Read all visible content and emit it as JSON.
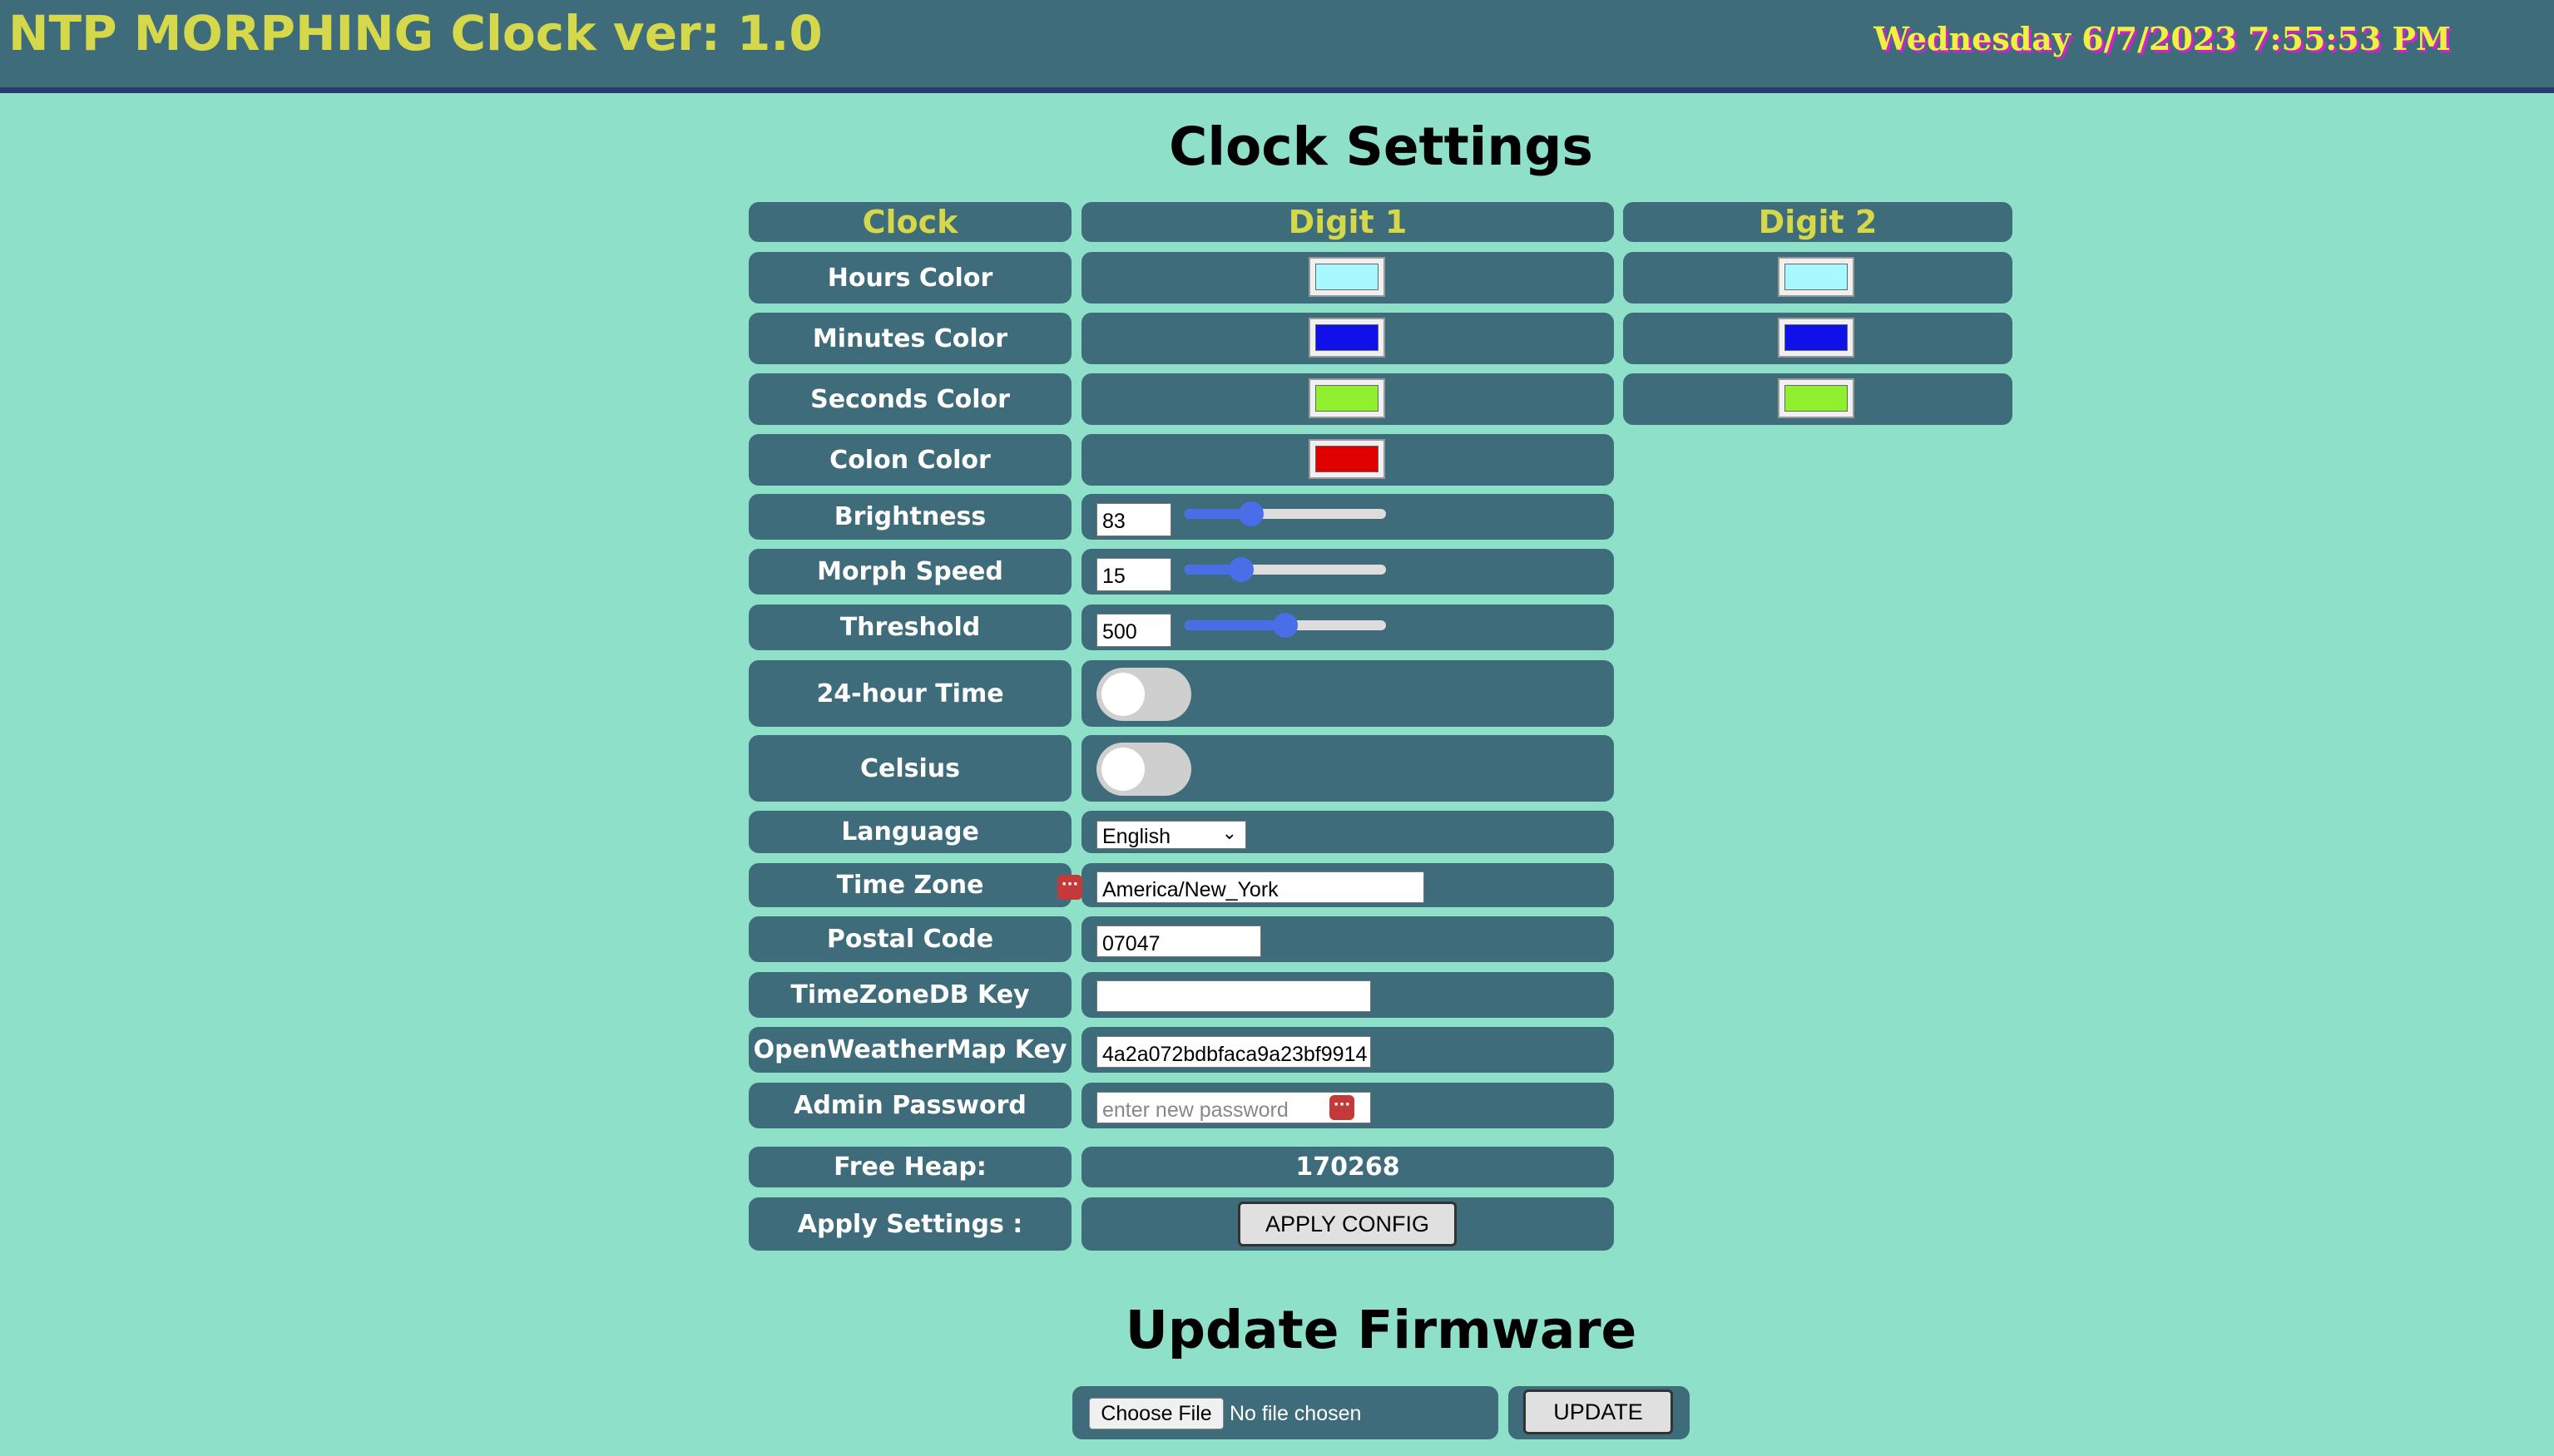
{
  "header": {
    "title": "NTP MORPHING Clock ver: 1.0",
    "datetime": "Wednesday 6/7/2023 7:55:53 PM"
  },
  "settings": {
    "heading": "Clock Settings",
    "columns": [
      "Clock",
      "Digit 1",
      "Digit 2"
    ],
    "colors": {
      "hours_label": "Hours Color",
      "minutes_label": "Minutes Color",
      "seconds_label": "Seconds Color",
      "colon_label": "Colon Color",
      "hours_d1": "#a8f8ff",
      "hours_d2": "#a8f8ff",
      "minutes_d1": "#1010e8",
      "minutes_d2": "#1010e8",
      "seconds_d1": "#90f030",
      "seconds_d2": "#90f030",
      "colon_d1": "#e00000"
    },
    "brightness": {
      "label": "Brightness",
      "value": "83",
      "fraction": 0.33
    },
    "morph_speed": {
      "label": "Morph Speed",
      "value": "15",
      "fraction": 0.28
    },
    "threshold": {
      "label": "Threshold",
      "value": "500",
      "fraction": 0.5
    },
    "time_24": {
      "label": "24-hour Time",
      "on": false
    },
    "celsius": {
      "label": "Celsius",
      "on": false
    },
    "language": {
      "label": "Language",
      "selected": "English"
    },
    "time_zone": {
      "label": "Time Zone",
      "value": "America/New_York"
    },
    "postal_code": {
      "label": "Postal Code",
      "value": "07047"
    },
    "timezonedb_key": {
      "label": "TimeZoneDB Key",
      "value": ""
    },
    "owm_key": {
      "label": "OpenWeatherMap Key",
      "value": "4a2a072bdbfaca9a23bf9914"
    },
    "admin_password": {
      "label": "Admin Password",
      "placeholder": "enter new password"
    },
    "free_heap": {
      "label": "Free Heap:",
      "value": "170268"
    },
    "apply": {
      "label": "Apply Settings :",
      "button": "APPLY CONFIG"
    },
    "dots_glyph": "···"
  },
  "firmware": {
    "heading": "Update Firmware",
    "choose_file": "Choose File",
    "no_file": "No file chosen",
    "update_button": "UPDATE"
  }
}
